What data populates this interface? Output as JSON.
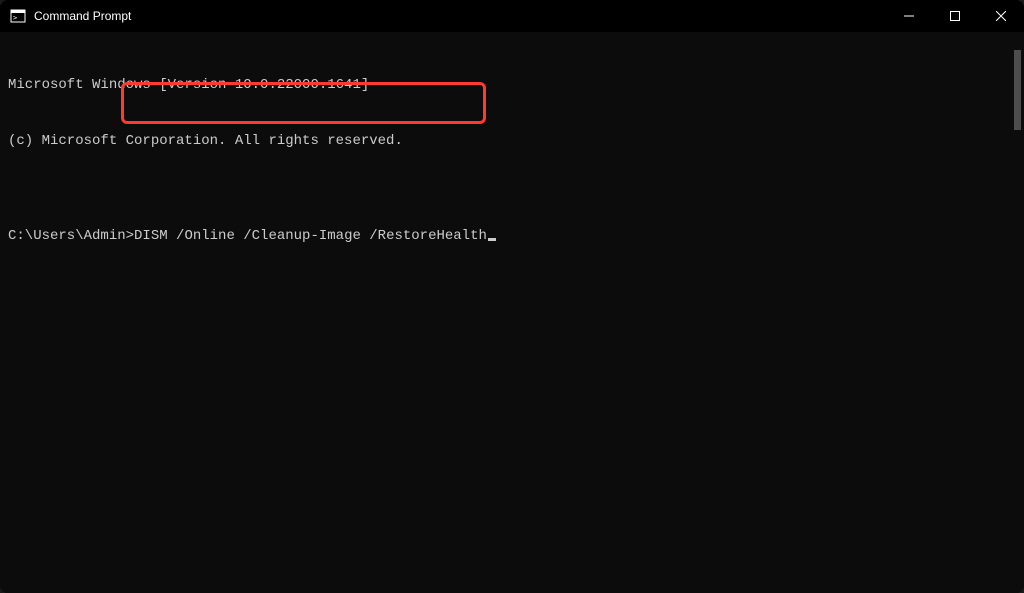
{
  "window": {
    "title": "Command Prompt"
  },
  "terminal": {
    "line1": "Microsoft Windows [Version 10.0.22000.1641]",
    "line2": "(c) Microsoft Corporation. All rights reserved.",
    "blank": "",
    "prompt": "C:\\Users\\Admin>",
    "command": "DISM /Online /Cleanup-Image /RestoreHealth"
  }
}
